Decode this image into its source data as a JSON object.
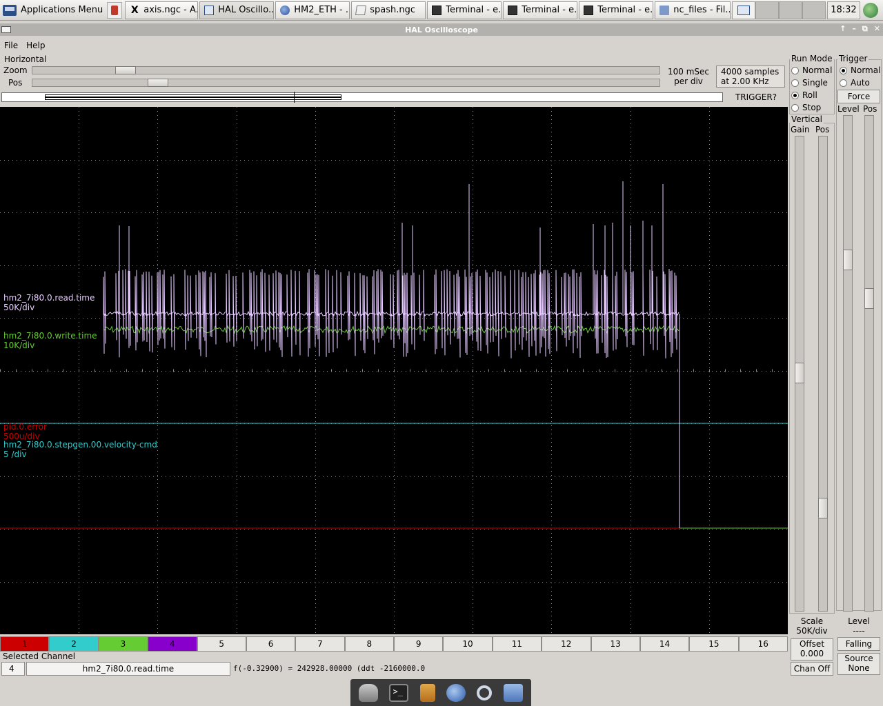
{
  "taskbar": {
    "app_menu": "Applications Menu",
    "tasks": [
      {
        "label": "axis.ngc - A...",
        "icon": "x-icon"
      },
      {
        "label": "HAL Oscillo...",
        "icon": "window-icon",
        "active": true
      },
      {
        "label": "HM2_ETH - ...",
        "icon": "globe-icon"
      },
      {
        "label": "spash.ngc",
        "icon": "document-icon"
      },
      {
        "label": "Terminal - e...",
        "icon": "terminal-icon"
      },
      {
        "label": "Terminal - e...",
        "icon": "terminal-icon"
      },
      {
        "label": "Terminal - e...",
        "icon": "terminal-icon"
      },
      {
        "label": "nc_files - Fil...",
        "icon": "folder-icon"
      }
    ],
    "clock": "18:32"
  },
  "window": {
    "title": "HAL Oscilloscope",
    "menu": {
      "file": "File",
      "help": "Help"
    }
  },
  "horizontal": {
    "title": "Horizontal",
    "zoom_label": "Zoom",
    "pos_label": "Pos",
    "zoom_value": 0.137,
    "pos_value": 0.19,
    "time_per_div": "100 mSec",
    "per_div": "per div",
    "samples": "4000 samples",
    "rate": "at 2.00 KHz",
    "trigger_status": "TRIGGER?"
  },
  "scope": {
    "channels": [
      {
        "name": "hm2_7i80.0.read.time",
        "scale": "50K/div",
        "color": "#e6ccff"
      },
      {
        "name": "hm2_7i80.0.write.time",
        "scale": "10K/div",
        "color": "#66cc33"
      },
      {
        "name": "pid.0.error",
        "scale": "500u/div",
        "color": "#cc0000"
      },
      {
        "name": "hm2_7i80.0.stepgen.00.velocity-cmd",
        "scale": "5 /div",
        "color": "#33cccc"
      }
    ]
  },
  "channel_buttons": [
    {
      "label": "1",
      "color": "#cc0000"
    },
    {
      "label": "2",
      "color": "#33cccc"
    },
    {
      "label": "3",
      "color": "#66cc33"
    },
    {
      "label": "4",
      "color": "#8800cc"
    },
    {
      "label": "5"
    },
    {
      "label": "6"
    },
    {
      "label": "7"
    },
    {
      "label": "8"
    },
    {
      "label": "9"
    },
    {
      "label": "10"
    },
    {
      "label": "11"
    },
    {
      "label": "12"
    },
    {
      "label": "13"
    },
    {
      "label": "14"
    },
    {
      "label": "15"
    },
    {
      "label": "16"
    }
  ],
  "selected": {
    "label": "Selected Channel",
    "number": "4",
    "name": "hm2_7i80.0.read.time",
    "cursor": "f(-0.32900) =  242928.00000 (ddt -2160000.0"
  },
  "run_mode": {
    "title": "Run Mode",
    "options": [
      "Normal",
      "Single",
      "Roll",
      "Stop"
    ],
    "selected": "Roll"
  },
  "trigger": {
    "title": "Trigger",
    "options": [
      "Normal",
      "Auto"
    ],
    "selected": "Normal",
    "force": "Force",
    "level_label": "Level",
    "pos_label": "Pos",
    "level_value": "Level",
    "level_readout": "----",
    "edge": "Falling",
    "source_label": "Source",
    "source_value": "None"
  },
  "vertical": {
    "title": "Vertical",
    "gain_label": "Gain",
    "pos_label": "Pos",
    "scale_label": "Scale",
    "scale_value": "50K/div",
    "offset_label": "Offset",
    "offset_value": "0.000",
    "chan_off": "Chan Off"
  }
}
